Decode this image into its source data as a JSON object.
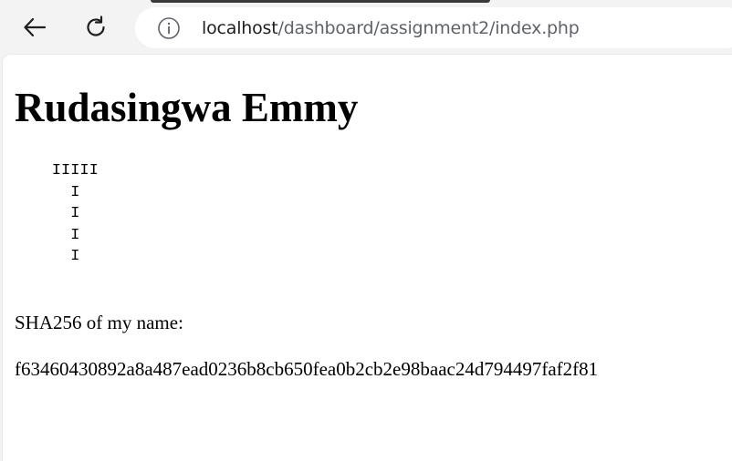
{
  "browser": {
    "url_host": "localhost",
    "url_path": "/dashboard/assignment2/index.php",
    "icons": {
      "back": "arrow-left-icon",
      "reload": "reload-icon",
      "site_info": "info-icon"
    }
  },
  "page": {
    "title": "Rudasingwa Emmy",
    "ascii_art": "    IIIII\n      I\n      I\n      I\n      I",
    "sha_label": "SHA256 of my name:",
    "sha_value": "f63460430892a8a487ead0236b8cb650fea0b2cb2e98baac24d794497faf2f81"
  }
}
